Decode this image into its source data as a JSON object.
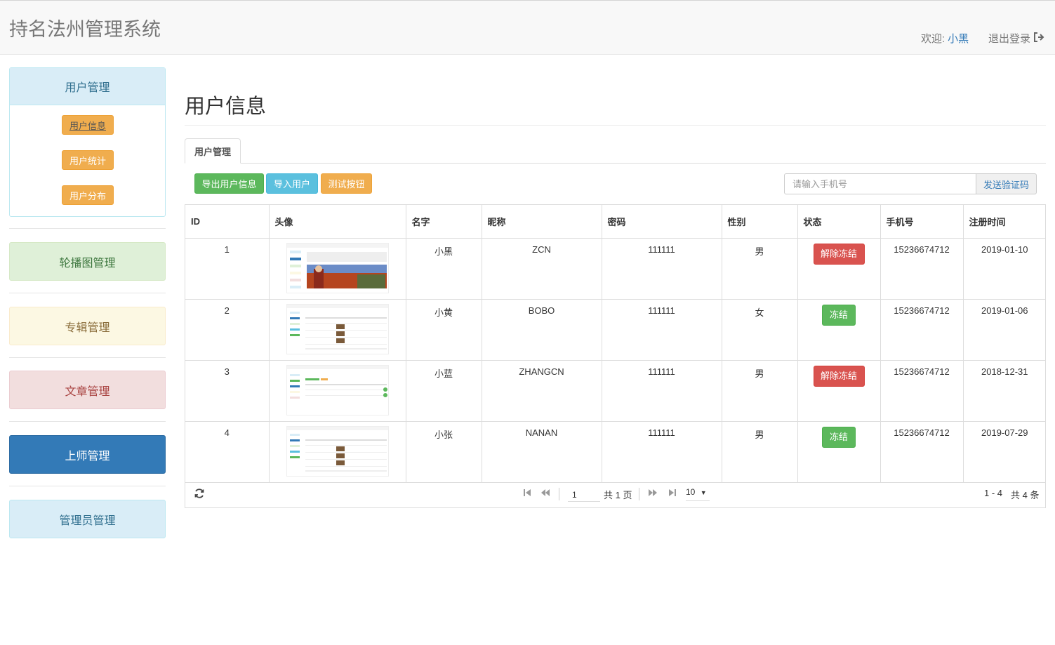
{
  "app": {
    "title": "持名法州管理系统"
  },
  "header": {
    "welcome_label": "欢迎:",
    "username": "小黑",
    "logout_label": "退出登录"
  },
  "sidebar": {
    "user_panel": {
      "title": "用户管理",
      "items": [
        "用户信息",
        "用户统计",
        "用户分布"
      ]
    },
    "items": [
      "轮播图管理",
      "专辑管理",
      "文章管理",
      "上师管理",
      "管理员管理"
    ]
  },
  "main": {
    "title": "用户信息",
    "tab": "用户管理",
    "toolbar": {
      "export": "导出用户信息",
      "import": "导入用户",
      "test": "测试按钮"
    },
    "phone": {
      "placeholder": "请输入手机号",
      "send": "发送验证码"
    }
  },
  "table": {
    "headers": [
      "ID",
      "头像",
      "名字",
      "昵称",
      "密码",
      "性别",
      "状态",
      "手机号",
      "注册时间"
    ],
    "rows": [
      {
        "id": "1",
        "name": "小黑",
        "nickname": "ZCN",
        "password": "111111",
        "gender": "男",
        "status": "解除冻结",
        "phone": "15236674712",
        "date": "2019-01-10"
      },
      {
        "id": "2",
        "name": "小黄",
        "nickname": "BOBO",
        "password": "111111",
        "gender": "女",
        "status": "冻结",
        "phone": "15236674712",
        "date": "2019-01-06"
      },
      {
        "id": "3",
        "name": "小蓝",
        "nickname": "ZHANGCN",
        "password": "111111",
        "gender": "男",
        "status": "解除冻结",
        "phone": "15236674712",
        "date": "2018-12-31"
      },
      {
        "id": "4",
        "name": "小张",
        "nickname": "NANAN",
        "password": "111111",
        "gender": "男",
        "status": "冻结",
        "phone": "15236674712",
        "date": "2019-07-29"
      }
    ]
  },
  "pager": {
    "page": "1",
    "total_pages": "共 1 页",
    "page_size": "10",
    "range": "1 - 4",
    "total": "共 4 条"
  },
  "colors": {
    "primary": "#337ab7",
    "success": "#5cb85c",
    "info": "#5bc0de",
    "warning": "#f0ad4e",
    "danger": "#d9534f"
  }
}
